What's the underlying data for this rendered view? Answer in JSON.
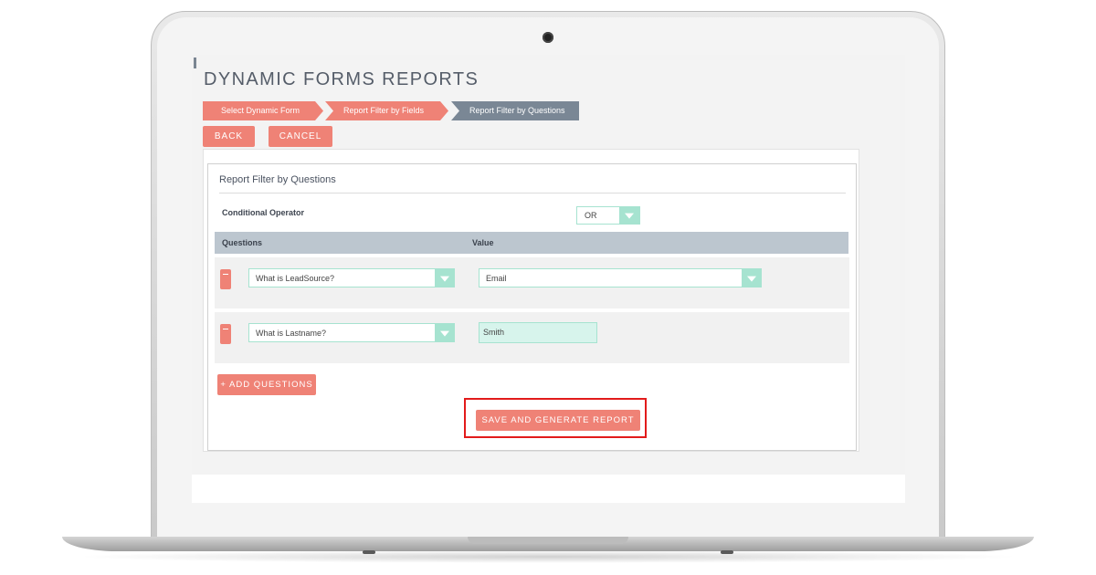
{
  "page": {
    "title": "DYNAMIC FORMS REPORTS"
  },
  "steps": [
    {
      "label": "Select Dynamic Form",
      "state": "completed"
    },
    {
      "label": "Report Filter by Fields",
      "state": "completed"
    },
    {
      "label": "Report Filter by Questions",
      "state": "active"
    }
  ],
  "actions": {
    "back_label": "BACK",
    "cancel_label": "CANCEL"
  },
  "panel": {
    "title": "Report Filter by Questions",
    "conditional_operator_label": "Conditional Operator",
    "conditional_operator_value": "OR",
    "columns": {
      "questions": "Questions",
      "value": "Value"
    },
    "rows": [
      {
        "question": "What is LeadSource?",
        "value": "Email",
        "value_type": "select"
      },
      {
        "question": "What is Lastname?",
        "value": "Smith",
        "value_type": "text"
      }
    ],
    "add_questions_label": "+ ADD QUESTIONS",
    "save_label": "SAVE AND GENERATE REPORT"
  },
  "colors": {
    "accent": "#ef8276",
    "step_active": "#7a8795",
    "select_border": "#a6e3d0",
    "table_header": "#bcc6cf",
    "highlight": "#e21b1b"
  }
}
